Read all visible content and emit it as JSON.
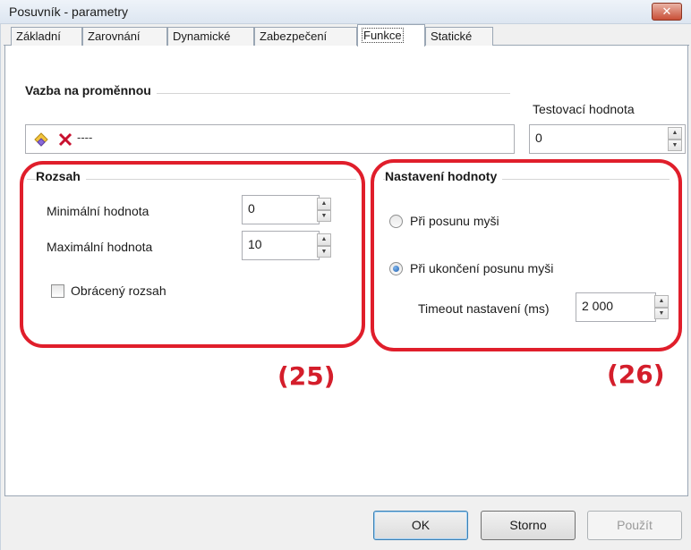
{
  "window": {
    "title": "Posuvník - parametry",
    "close_glyph": "✕"
  },
  "tabs": [
    {
      "label": "Základní"
    },
    {
      "label": "Zarovnání"
    },
    {
      "label": "Dynamické"
    },
    {
      "label": "Zabezpečení"
    },
    {
      "label": "Funkce",
      "active": true
    },
    {
      "label": "Statické"
    }
  ],
  "binding": {
    "heading": "Vazba na proměnnou",
    "value": "----",
    "icons": [
      "variable-pick-icon",
      "delete-icon"
    ],
    "test_label": "Testovací hodnota",
    "test_value": "0"
  },
  "range": {
    "heading": "Rozsah",
    "min_label": "Minimální hodnota",
    "min_value": "0",
    "max_label": "Maximální hodnota",
    "max_value": "10",
    "reverse_label": "Obrácený rozsah",
    "reverse_checked": false
  },
  "value_setting": {
    "heading": "Nastavení hodnoty",
    "option_move": "Při posunu myši",
    "option_end": "Při ukončení posunu myši",
    "selected": "option_end",
    "timeout_label": "Timeout nastavení (ms)",
    "timeout_value": "2 000"
  },
  "annotations": {
    "left": "(25)",
    "right": "(26)",
    "color": "#e01e2b"
  },
  "buttons": {
    "ok": "OK",
    "cancel": "Storno",
    "apply": "Použít"
  }
}
